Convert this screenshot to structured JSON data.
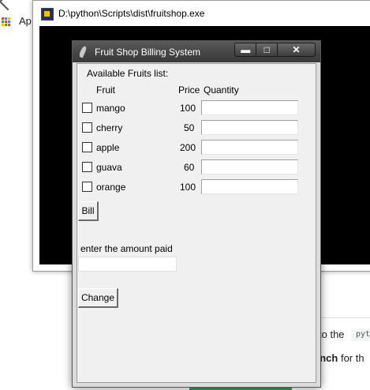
{
  "background": {
    "apps_label": "Ap",
    "text_fragment_1": "to the",
    "code_fragment": "pyt",
    "text_fragment_2_bold": "anch",
    "text_fragment_2_rest": " for th"
  },
  "console": {
    "title": "D:\\python\\Scripts\\dist\\fruitshop.exe"
  },
  "app": {
    "title": "Fruit Shop Billing System",
    "controls": {
      "minimize": "▬",
      "maximize": "□",
      "close": "✕"
    },
    "section_heading": "Available Fruits list:",
    "headers": {
      "fruit": "Fruit",
      "price": "Price",
      "quantity": "Quantity"
    },
    "fruits": [
      {
        "name": "mango",
        "price": "100",
        "checked": false,
        "quantity": ""
      },
      {
        "name": "cherry",
        "price": "50",
        "checked": false,
        "quantity": ""
      },
      {
        "name": "apple",
        "price": "200",
        "checked": false,
        "quantity": ""
      },
      {
        "name": "guava",
        "price": "60",
        "checked": false,
        "quantity": ""
      },
      {
        "name": "orange",
        "price": "100",
        "checked": false,
        "quantity": ""
      }
    ],
    "bill_button": "Bill",
    "amount_label": "enter the amount paid",
    "amount_value": "",
    "change_button": "Change"
  }
}
